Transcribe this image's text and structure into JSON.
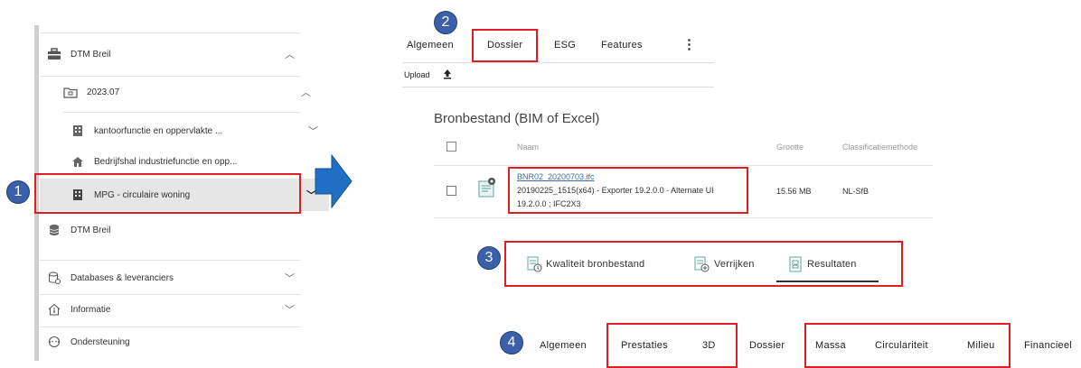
{
  "sidebar": {
    "items": [
      {
        "label": "DTM Breil",
        "icon": "briefcase-icon",
        "chevron": "^"
      },
      {
        "label": "2023.07",
        "icon": "folder-icon",
        "chevron": "^"
      },
      {
        "label": "kantoorfunctie en oppervlakte ...",
        "icon": "building-icon",
        "chevron": "v"
      },
      {
        "label": "Bedrijfshal industriefunctie en opp...",
        "icon": "house-icon",
        "chevron": ""
      },
      {
        "label": "MPG - circulaire woning",
        "icon": "building-icon",
        "chevron": "v"
      },
      {
        "label": "DTM Breil",
        "icon": "database-icon",
        "chevron": ""
      }
    ],
    "bottom": [
      {
        "label": "Databases & leveranciers",
        "icon": "database-settings-icon",
        "chevron": "v"
      },
      {
        "label": "Informatie",
        "icon": "info-home-icon",
        "chevron": "v"
      },
      {
        "label": "Ondersteuning",
        "icon": "support-icon",
        "chevron": ""
      }
    ]
  },
  "badges": [
    "1",
    "2",
    "3",
    "4"
  ],
  "top_tabs": [
    "Algemeen",
    "Dossier",
    "ESG",
    "Features"
  ],
  "upload_label": "Upload",
  "section_title": "Bronbestand (BIM of Excel)",
  "table": {
    "headers": [
      "Naam",
      "Grootte",
      "Classificatiemethode"
    ],
    "row": {
      "file_link": "BNR02_20200703.ifc",
      "desc_line1": "20190225_1515(x64) - Exporter 19.2.0.0 - Alternate UI",
      "desc_line2": "19.2.0.0 ; IFC2X3",
      "size": "15.56 MB",
      "classification": "NL-SfB"
    }
  },
  "action_tabs": [
    "Kwaliteit bronbestand",
    "Verrijken",
    "Resultaten"
  ],
  "bottom_tabs": [
    "Algemeen",
    "Prestaties",
    "3D",
    "Dossier",
    "Massa",
    "Circulariteit",
    "Milieu",
    "Financieel"
  ],
  "colors": {
    "highlight": "#e02020",
    "badge": "#3b5fa8",
    "arrow": "#1f6fc5",
    "file_icon": "#5aa7a0"
  }
}
